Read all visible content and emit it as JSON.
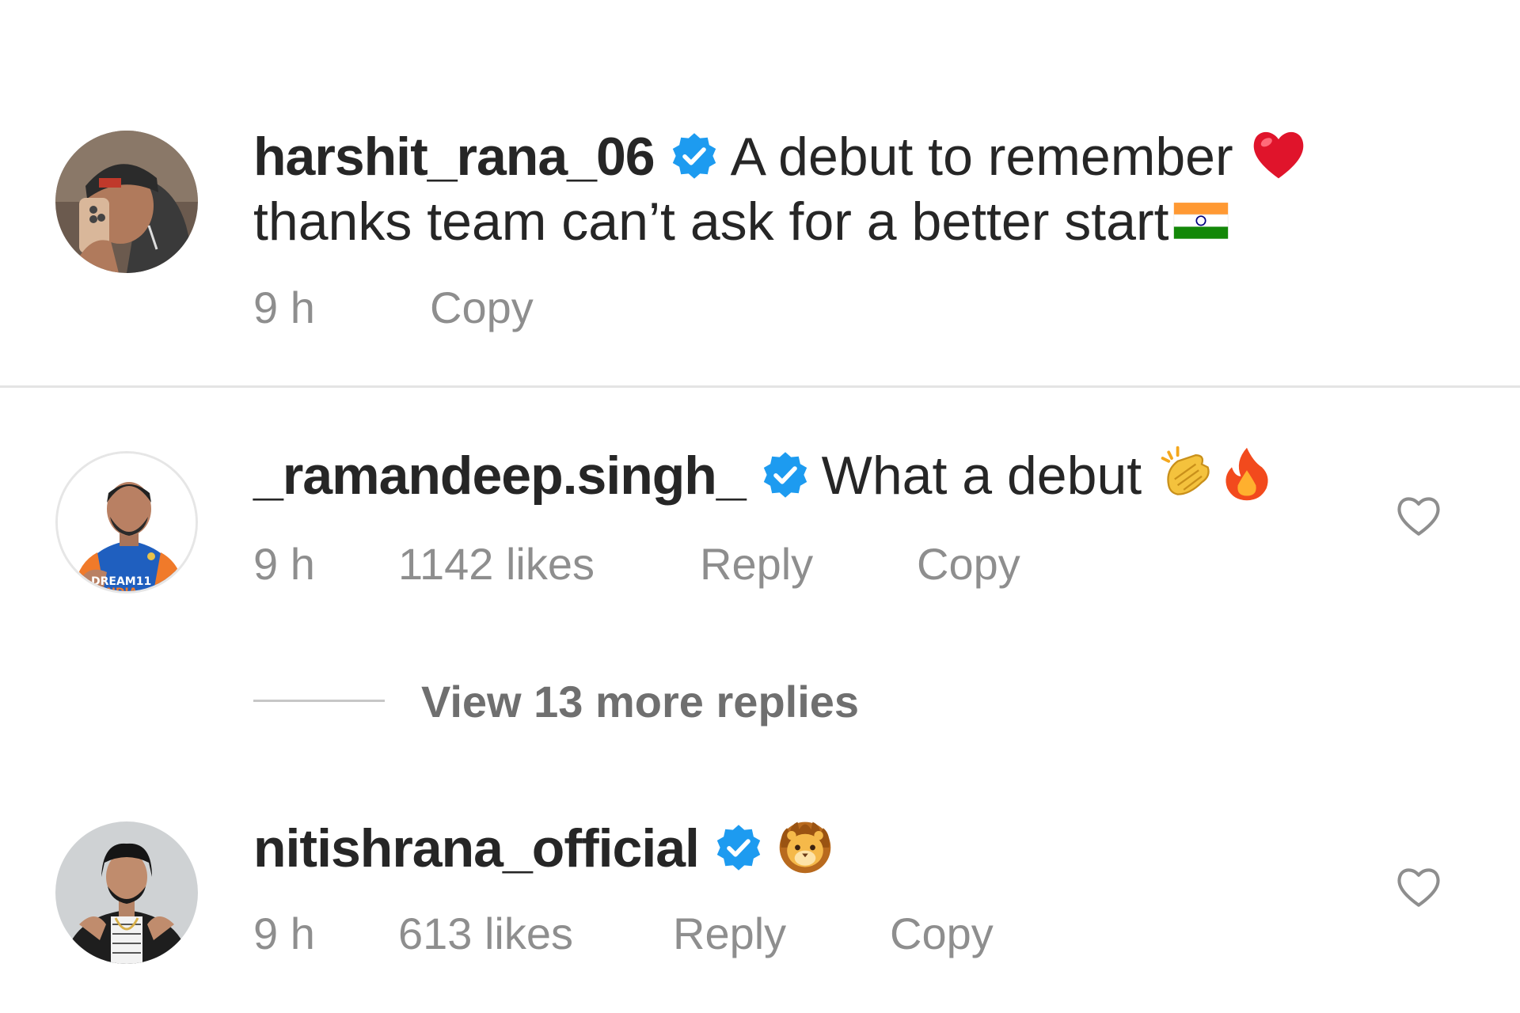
{
  "comments": [
    {
      "username": "harshit_rana_06",
      "verified": true,
      "text_line1": "A debut to remember",
      "text_line2": "thanks team can’t ask for a better start",
      "emojis": [
        "red-heart",
        "india-flag"
      ],
      "time": "9 h",
      "copy_label": "Copy"
    },
    {
      "username": "_ramandeep.singh_",
      "verified": true,
      "text": "What a debut",
      "emojis": [
        "clapping-hands",
        "fire"
      ],
      "time": "9 h",
      "likes": "1142 likes",
      "reply_label": "Reply",
      "copy_label": "Copy",
      "avatar_jersey_text": [
        "DREAM11",
        "INDIA"
      ]
    },
    {
      "username": "nitishrana_official",
      "verified": true,
      "text": "",
      "emojis": [
        "lion-face"
      ],
      "time": "9 h",
      "likes": "613 likes",
      "reply_label": "Reply",
      "copy_label": "Copy"
    }
  ],
  "view_replies": {
    "label": "View 13 more replies"
  },
  "colors": {
    "text": "#262626",
    "secondary": "#8e8e8e",
    "verified": "#1d9bf0",
    "divider": "#e4e4e4"
  }
}
